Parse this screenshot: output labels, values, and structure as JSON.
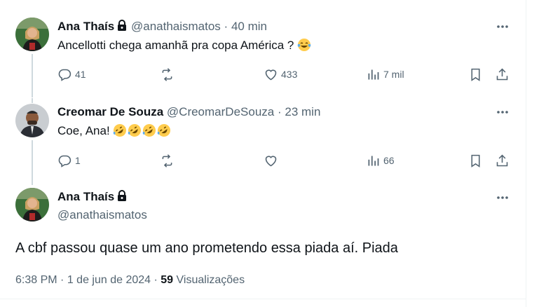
{
  "tweets": [
    {
      "name": "Ana Thaís",
      "handle": "@anathaismatos",
      "separator": "·",
      "time": "40 min",
      "text": "Ancellotti chega amanhã pra copa América ?",
      "emojis": [
        "face-with-tears-of-joy"
      ],
      "replies": "41",
      "retweets": "",
      "likes": "433",
      "views": "7 mil",
      "avatar": "avatar-photo-woman"
    },
    {
      "name": "Creomar De Souza",
      "handle": "@CreomarDeSouza",
      "separator": "·",
      "time": "23 min",
      "text": "Coe, Ana!",
      "emojis": [
        "rolling-on-the-floor-laughing",
        "rolling-on-the-floor-laughing",
        "rolling-on-the-floor-laughing",
        "rolling-on-the-floor-laughing"
      ],
      "replies": "1",
      "retweets": "",
      "likes": "",
      "views": "66",
      "avatar": "avatar-photo-man"
    }
  ],
  "main_tweet": {
    "name": "Ana Thaís",
    "handle": "@anathaismatos",
    "text": "A cbf passou quase um ano prometendo essa piada aí. Piada",
    "time": "6:38 PM",
    "separator": "·",
    "date": "1 de jun de 2024",
    "views_count": "59",
    "views_label": "Visualizações"
  },
  "colors": {
    "text": "#0f1419",
    "secondary": "#536471",
    "thread_line": "#cfd9de"
  },
  "icons": [
    "more-icon",
    "lock-icon",
    "reply-icon",
    "retweet-icon",
    "like-icon",
    "views-icon",
    "bookmark-icon",
    "share-icon"
  ]
}
